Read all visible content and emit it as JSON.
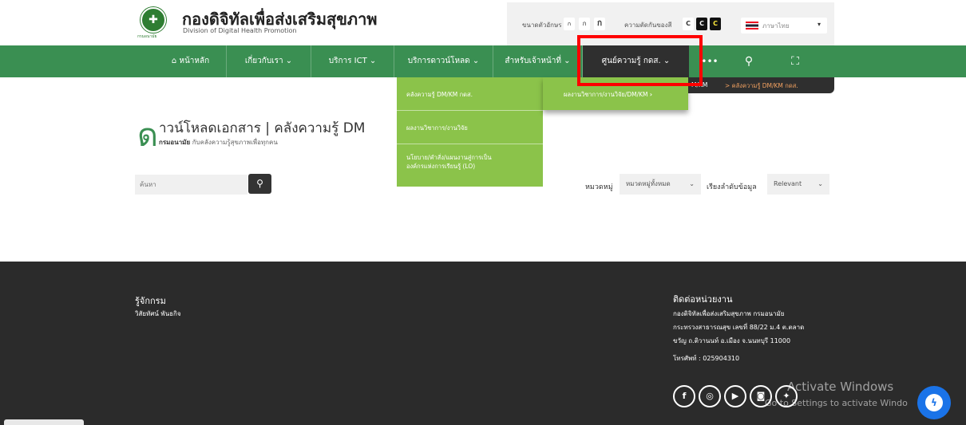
{
  "header": {
    "site_title": "กองดิจิทัลเพื่อส่งเสริมสุขภาพ",
    "site_subtitle": "Division of Digital Health Promotion",
    "logo_caption": "กรมอนามัย"
  },
  "toolbar": {
    "font_size_label": "ขนาดตัวอักษร",
    "font_small": "ก",
    "font_medium": "ก",
    "font_large": "ก",
    "contrast_label": "ความตัดกันของสี",
    "contrast_normal": "C",
    "contrast_high1": "C",
    "contrast_high2": "C",
    "language": "ภาษาไทย"
  },
  "nav": {
    "home": "หน้าหลัก",
    "about": "เกี่ยวกับเรา",
    "ict": "บริการ ICT",
    "download": "บริการดาวน์โหลด",
    "staff": "สำหรับเจ้าหน้าที่",
    "km_center": "ศูนย์ความรู้ กดส."
  },
  "dropdown": {
    "items": [
      "คลังความรู้ DM/KM กดส.",
      "ผลงานวิชาการ/งานวิจัย",
      "นโยบาย/คำสั่ง/แผนงานสู่การเป็น",
      "องค์กรแห่งการเรียนรู้ (LO)"
    ],
    "sub_item": "ผลงานวิชาการ/งานวิจัย/DM/KM",
    "breadcrumb_prev": "M/KM",
    "breadcrumb_current": "> คลังความรู้ DM/KM กดส."
  },
  "page": {
    "title_initial": "ด",
    "title": "าวน์โหลดเอกสาร | คลังความรู้ DM",
    "subtitle_bold": "กรมอนามัย",
    "subtitle": "กับคลังความรู้สุขภาพเพื่อทุกคน",
    "search_placeholder": "ค้นหา",
    "category_label": "หมวดหมู่",
    "category_value": "หมวดหมู่ทั้งหมด",
    "sort_label": "เรียงลำดับข้อมูล",
    "sort_value": "Relevant"
  },
  "footer": {
    "about_title": "รู้จักกรม",
    "about_link": "วิสัยทัศน์ พันธกิจ",
    "contact_title": "ติดต่อหน่วยงาน",
    "address_line1": "กองดิจิทัลเพื่อส่งเสริมสุขภาพ กรมอนามัย",
    "address_line2": "กระทรวงสาธารณสุข เลขที่ 88/22 ม.4 ต.ตลาด",
    "address_line3": "ขวัญ ถ.ติวานนท์ อ.เมือง จ.นนทบุรี 11000",
    "phone": "โทรศัพท์ : 025904310"
  },
  "watermark": {
    "line1": "Activate Windows",
    "line2": "Go to Settings to activate Windo"
  }
}
